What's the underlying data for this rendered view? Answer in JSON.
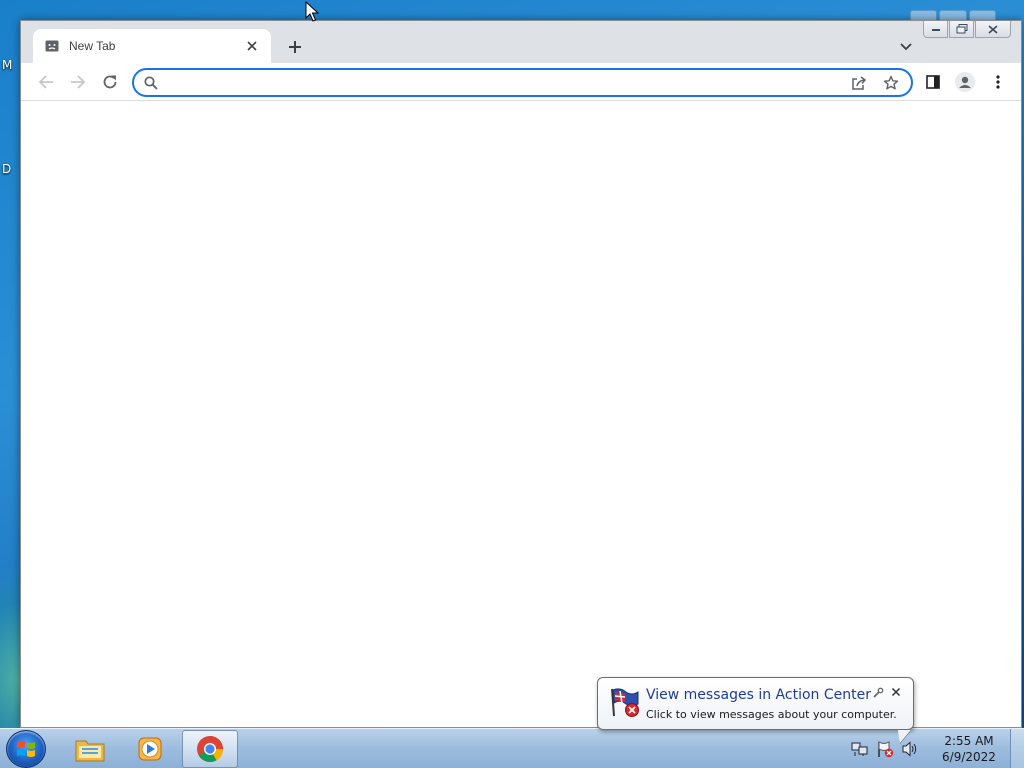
{
  "desktop": {
    "edge_text_1": "M",
    "edge_text_2": "D"
  },
  "browser": {
    "tab": {
      "title": "New Tab"
    },
    "omnibox": {
      "value": "",
      "placeholder": ""
    },
    "icons": {
      "back": "arrow-left-icon",
      "forward": "arrow-right-icon",
      "reload": "reload-icon",
      "search": "search-icon",
      "share": "share-icon",
      "bookmark": "star-icon",
      "side_panel": "side-panel-icon",
      "profile": "profile-icon",
      "menu": "kebab-menu-icon"
    },
    "colors": {
      "tab_strip": "#dee1e6",
      "focus_ring": "#1a73e8",
      "icon": "#5f6368",
      "disabled_icon": "#c4c7cc"
    }
  },
  "taskbar": {
    "apps": [
      {
        "name": "Windows Explorer",
        "icon": "folder-icon",
        "active": false
      },
      {
        "name": "Windows Media Player",
        "icon": "media-player-icon",
        "active": false
      },
      {
        "name": "Google Chrome",
        "icon": "chrome-icon",
        "active": true
      }
    ],
    "clock": {
      "time": "2:55 AM",
      "date": "6/9/2022"
    }
  },
  "notification": {
    "title": "View messages in Action Center",
    "text": "Click to view messages about your computer."
  }
}
